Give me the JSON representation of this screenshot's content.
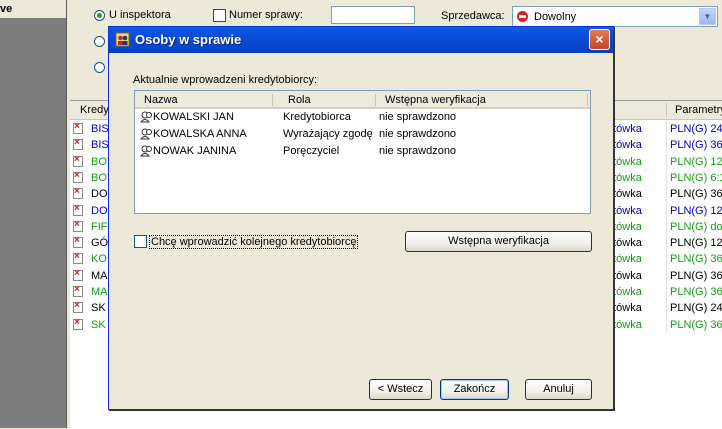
{
  "background": {
    "left_pane_title": "ve",
    "filters": {
      "radio_u_inspektora": "U inspektora",
      "checkbox_numer_sprawy": "Numer sprawy:",
      "sprzedawca_label": "Sprzedawca:",
      "sprzedawca_value": "Dowolny"
    },
    "list": {
      "columns": [
        "Kredy",
        "Parametry"
      ],
      "rows": [
        {
          "name": "BIS",
          "type": "otówka",
          "param": "PLN(G) 24",
          "color": "blue"
        },
        {
          "name": "BIS",
          "type": "otówka",
          "param": "PLN(G) 36",
          "color": "blue"
        },
        {
          "name": "BO",
          "type": "otówka",
          "param": "PLN(G) 12",
          "color": "green"
        },
        {
          "name": "BO",
          "type": "otówka",
          "param": "PLN(G) 6:1",
          "color": "green"
        },
        {
          "name": "DO",
          "type": "otówka",
          "param": "PLN(G) 36",
          "color": "black"
        },
        {
          "name": "DO",
          "type": "otówka",
          "param": "PLN(G) 12",
          "color": "blue"
        },
        {
          "name": "FIF",
          "type": "otówka",
          "param": "PLN(G) do",
          "color": "green"
        },
        {
          "name": "GÓ",
          "type": "otówka",
          "param": "PLN(G) 12",
          "color": "black"
        },
        {
          "name": "KO",
          "type": "otówka",
          "param": "PLN(G) 36",
          "color": "green"
        },
        {
          "name": "MA",
          "type": "otówka",
          "param": "PLN(G) 36",
          "color": "black"
        },
        {
          "name": "MA",
          "type": "otówka",
          "param": "PLN(G) 36",
          "color": "green"
        },
        {
          "name": "SK",
          "type": "otówka",
          "param": "PLN(G) 24",
          "color": "black"
        },
        {
          "name": "SK",
          "type": "otówka",
          "param": "PLN(G) 36",
          "color": "green"
        }
      ]
    }
  },
  "dialog": {
    "title": "Osoby w sprawie",
    "close_label": "×",
    "section_label": "Aktualnie wprowadzeni kredytobiorcy:",
    "columns": {
      "name": "Nazwa",
      "role": "Rola",
      "verification": "Wstępna weryfikacja"
    },
    "persons": [
      {
        "name": "KOWALSKI JAN",
        "role": "Kredytobiorca",
        "verification": "nie sprawdzono"
      },
      {
        "name": "KOWALSKA ANNA",
        "role": "Wyrażający zgodę",
        "verification": "nie sprawdzono"
      },
      {
        "name": "NOWAK JANINA",
        "role": "Poręczyciel",
        "verification": "nie sprawdzono"
      }
    ],
    "add_another_label": "Chcę wprowadzić kolejnego kredytobiorcę",
    "verify_button": "Wstępna weryfikacja",
    "back_button": "< Wstecz",
    "finish_button": "Zakończ",
    "cancel_button": "Anuluj"
  },
  "colors": {
    "title_bar": "#0a4ad4",
    "green_row": "#12a012",
    "blue_row": "#0000cc",
    "close_button": "#c44425"
  }
}
